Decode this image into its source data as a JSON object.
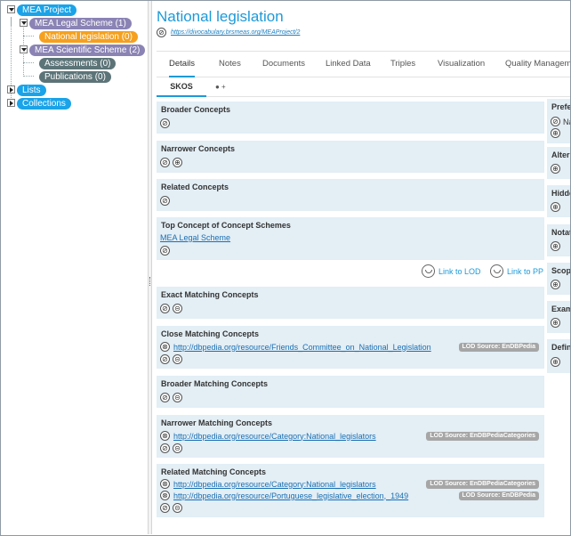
{
  "tree": {
    "root": "MEA Project",
    "legal_scheme": "MEA Legal Scheme (1)",
    "national_legislation": "National legislation (0)",
    "scientific_scheme": "MEA Scientific Scheme (2)",
    "assessments": "Assessments (0)",
    "publications": "Publications (0)",
    "lists": "Lists",
    "collections": "Collections"
  },
  "header": {
    "title": "National legislation",
    "uri": "https://divocabulary.brsmeas.org/MEAProject/2"
  },
  "tabs": [
    "Details",
    "Notes",
    "Documents",
    "Linked Data",
    "Triples",
    "Visualization",
    "Quality Manageme"
  ],
  "subtabs": {
    "skos": "SKOS",
    "person": "● +"
  },
  "sections": {
    "broader": "Broader Concepts",
    "narrower": "Narrower Concepts",
    "related": "Related Concepts",
    "top_concept": "Top Concept of Concept Schemes",
    "top_concept_link": "MEA Legal Scheme",
    "exact_matching": "Exact Matching Concepts",
    "close_matching": "Close Matching Concepts",
    "close_link": "http://dbpedia.org/resource/Friends_Committee_on_National_Legislation",
    "close_badge": "LOD Source: EnDBPedia",
    "broader_matching": "Broader Matching Concepts",
    "narrower_matching": "Narrower Matching Concepts",
    "narrower_link": "http://dbpedia.org/resource/Category:National_legislators",
    "narrower_badge": "LOD Source: EnDBPediaCategories",
    "related_matching": "Related Matching Concepts",
    "related_link1": "http://dbpedia.org/resource/Category:National_legislators",
    "related_badge1": "LOD Source: EnDBPediaCategories",
    "related_link2": "http://dbpedia.org/resource/Portuguese_legislative_election,_1949",
    "related_badge2": "LOD Source: EnDBPedia"
  },
  "lod": {
    "link_lod": "Link to LOD",
    "link_pp": "Link to PP"
  },
  "right_panel": {
    "pref": "Prefe",
    "pref_value": "Na",
    "alt": "Altern",
    "hidden": "Hidde",
    "notation": "Notat",
    "scope": "Scop",
    "example": "Exam",
    "definition": "Defin"
  },
  "icons": {
    "edit": "⊘",
    "add": "⊕",
    "remove": "⊗",
    "minus": "⊝"
  },
  "colors": {
    "accent": "#1d9ad8",
    "pill_blue": "#1aa3e8",
    "pill_purple": "#8a83b4",
    "pill_orange": "#f5a01e",
    "pill_slate": "#5c7478",
    "section_bg": "#e3eef5"
  }
}
